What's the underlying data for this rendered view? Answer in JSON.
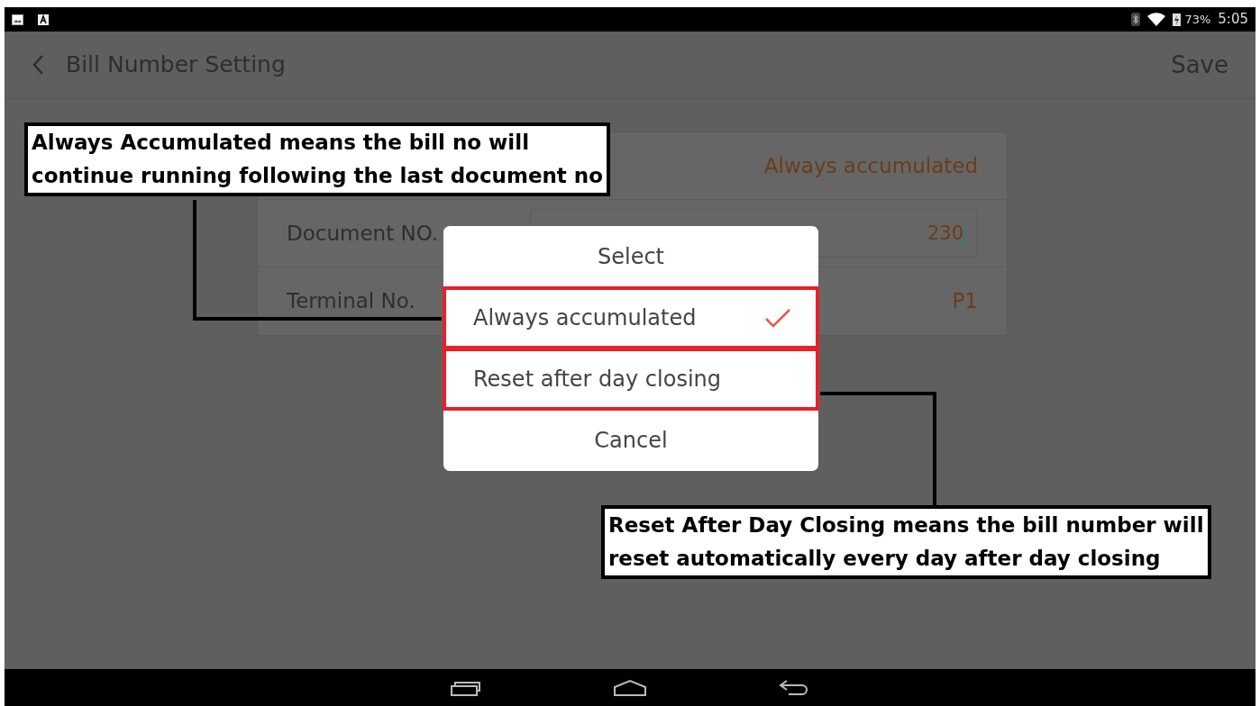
{
  "status_bar": {
    "battery": "73%",
    "time": "5:05"
  },
  "app_bar": {
    "title": "Bill Number Setting",
    "action": "Save"
  },
  "settings": [
    {
      "kind": "value",
      "value": "Always accumulated"
    },
    {
      "kind": "input",
      "label": "Document NO.",
      "value": "230"
    },
    {
      "kind": "value",
      "label": "Terminal No.",
      "value": "P1"
    }
  ],
  "dialog": {
    "title": "Select",
    "options": [
      {
        "label": "Always accumulated",
        "selected": true,
        "highlighted": true
      },
      {
        "label": "Reset after day closing",
        "selected": false,
        "highlighted": true
      }
    ],
    "cancel": "Cancel"
  },
  "callouts": [
    {
      "lines": [
        "Always Accumulated means the bill no will",
        "continue running following the last document no"
      ]
    },
    {
      "lines": [
        "Reset After Day Closing means the bill number will",
        "reset automatically every day after day closing"
      ]
    }
  ]
}
